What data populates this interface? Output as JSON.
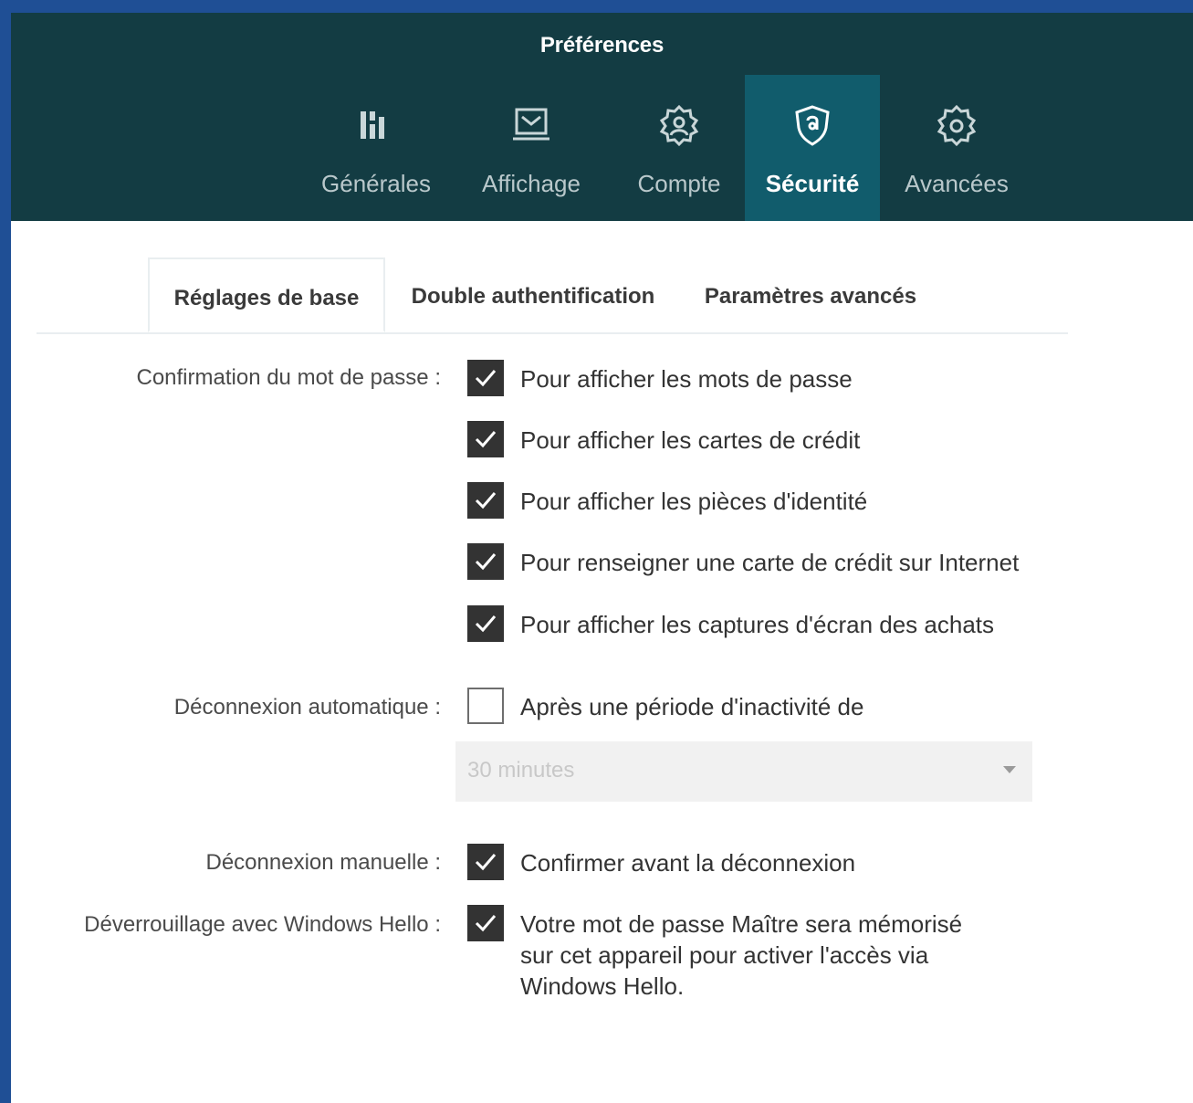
{
  "window": {
    "title": "Préférences"
  },
  "nav": {
    "items": [
      {
        "label": "Générales",
        "icon": "general-icon"
      },
      {
        "label": "Affichage",
        "icon": "display-icon"
      },
      {
        "label": "Compte",
        "icon": "account-gear-icon"
      },
      {
        "label": "Sécurité",
        "icon": "security-shield-icon",
        "active": true
      },
      {
        "label": "Avancées",
        "icon": "advanced-gear-icon"
      }
    ]
  },
  "tabs": [
    {
      "label": "Réglages de base",
      "active": true
    },
    {
      "label": "Double authentification"
    },
    {
      "label": "Paramètres avancés"
    }
  ],
  "password_confirmation": {
    "label": "Confirmation du mot de passe :",
    "options": [
      {
        "text": "Pour afficher les mots de passe",
        "checked": true
      },
      {
        "text": "Pour afficher les cartes de crédit",
        "checked": true
      },
      {
        "text": "Pour afficher les pièces d'identité",
        "checked": true
      },
      {
        "text": "Pour renseigner une carte de crédit sur Internet",
        "checked": true
      },
      {
        "text": "Pour afficher les captures d'écran des achats",
        "checked": true
      }
    ]
  },
  "auto_logout": {
    "label": "Déconnexion automatique :",
    "option": {
      "text": "Après une période d'inactivité de",
      "checked": false
    },
    "select_value": "30 minutes"
  },
  "manual_logout": {
    "label": "Déconnexion manuelle :",
    "option": {
      "text": "Confirmer avant la déconnexion",
      "checked": true
    }
  },
  "windows_hello": {
    "label": "Déverrouillage avec Windows Hello :",
    "option": {
      "line1": "Votre mot de passe Maître sera mémorisé",
      "line2": "sur cet appareil pour activer l'accès via",
      "line3": "Windows Hello.",
      "checked": true
    }
  },
  "colors": {
    "frame": "#1f4f95",
    "header": "#133c43",
    "active_nav": "#115c6c",
    "checkbox": "#333333"
  }
}
